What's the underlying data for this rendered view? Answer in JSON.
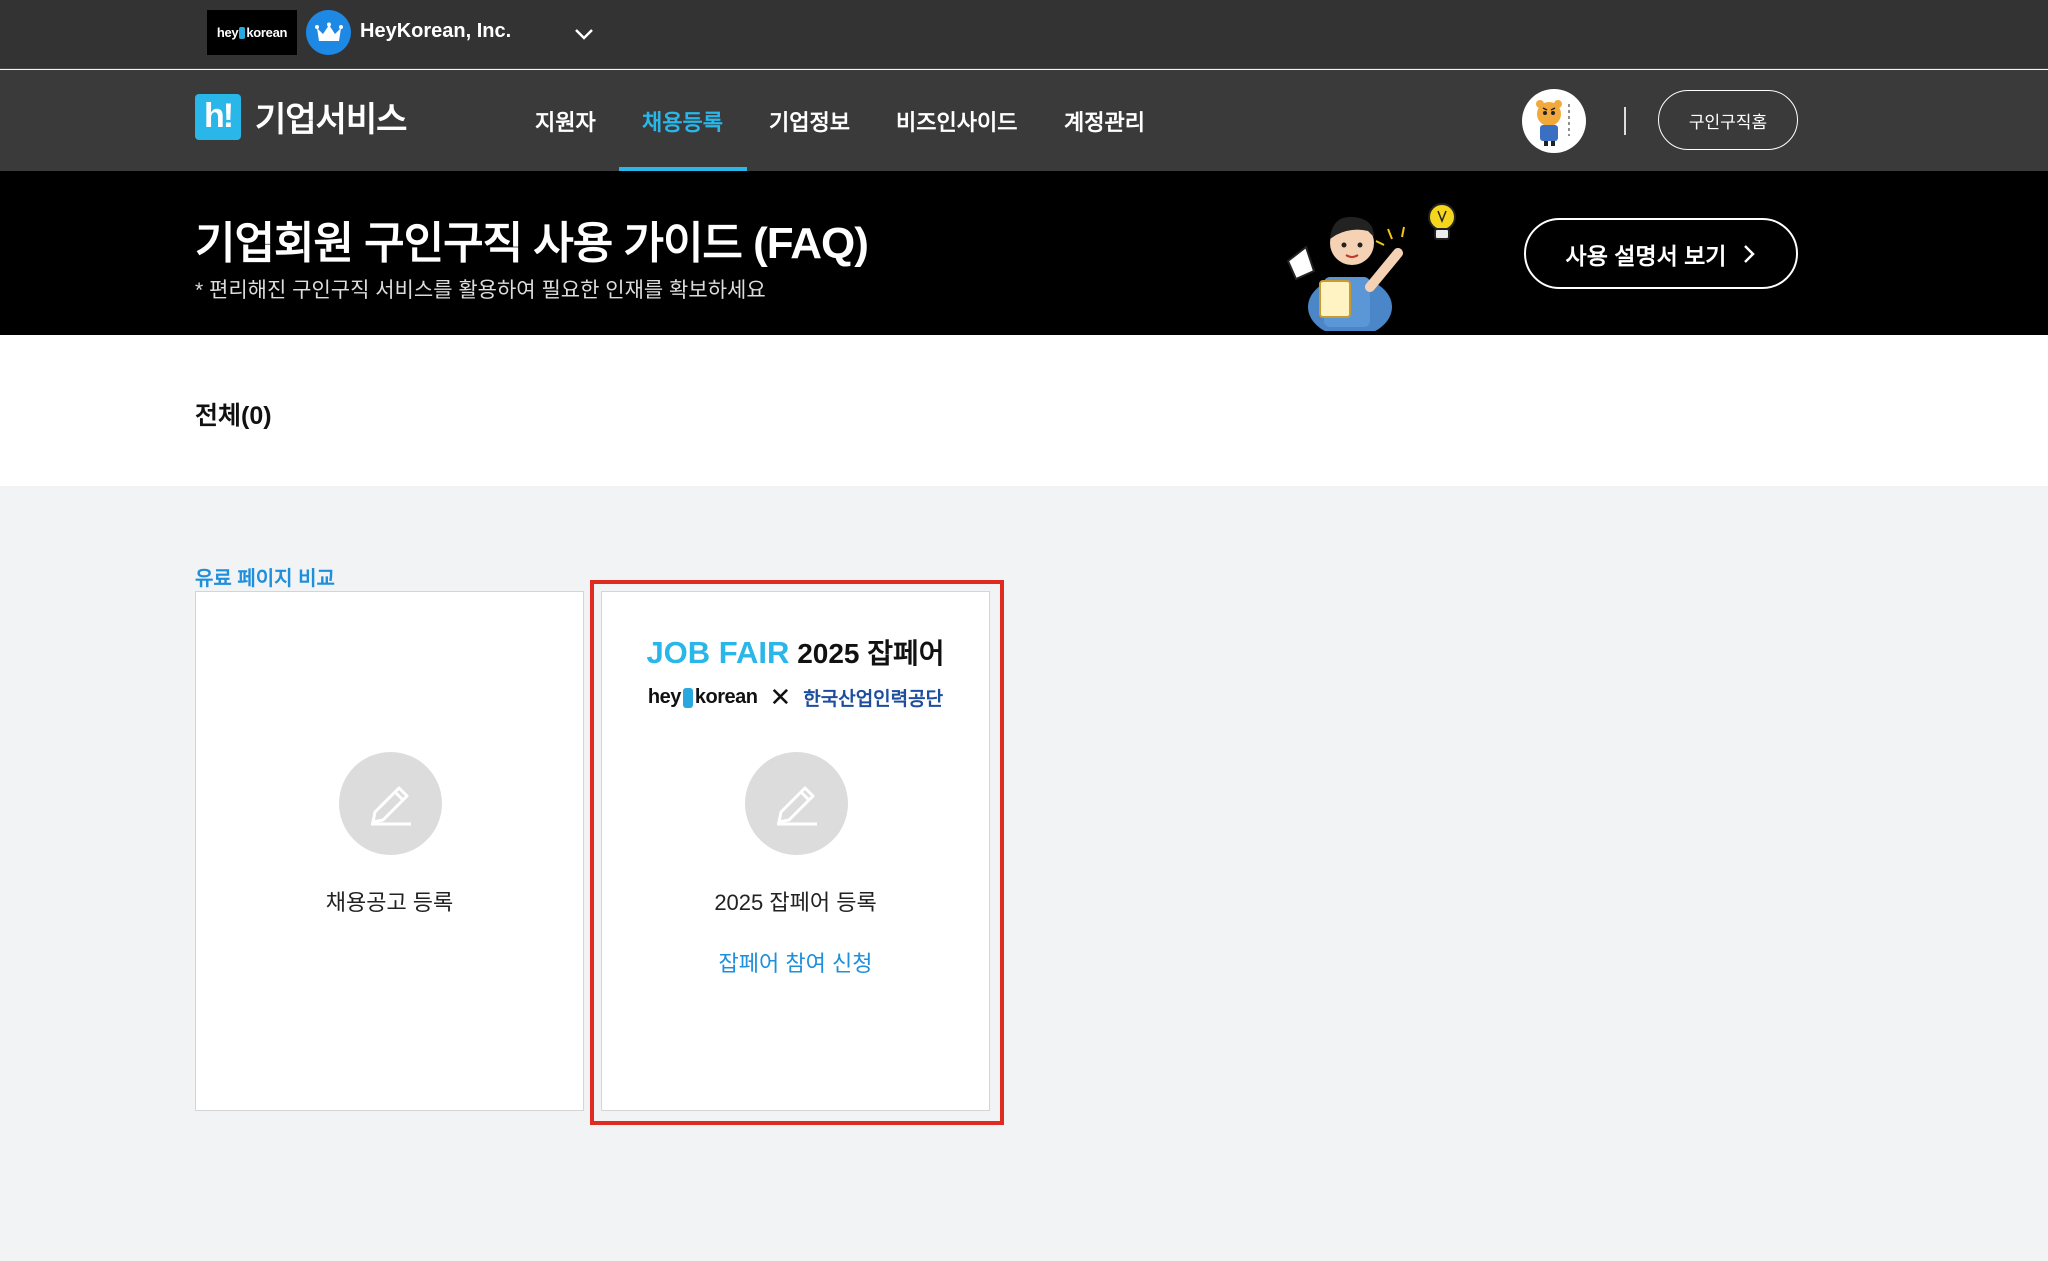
{
  "topbar": {
    "logo_text_left": "hey",
    "logo_text_right": "korean",
    "company_name": "HeyKorean, Inc."
  },
  "nav": {
    "brand_mark": "h!",
    "brand_name": "기업서비스",
    "items": [
      {
        "label": "지원자"
      },
      {
        "label": "채용등록",
        "active": true
      },
      {
        "label": "기업정보"
      },
      {
        "label": "비즈인사이드"
      },
      {
        "label": "계정관리"
      }
    ],
    "home_button": "구인구직홈"
  },
  "banner": {
    "title": "기업회원 구인구직 사용 가이드 (FAQ)",
    "subtitle": "* 편리해진 구인구직 서비스를 활용하여 필요한 인재를 확보하세요",
    "manual_button": "사용 설명서 보기"
  },
  "filter": {
    "all_label": "전체(0)"
  },
  "cards_section": {
    "compare_link": "유료 페이지 비교",
    "card1": {
      "label": "채용공고 등록"
    },
    "card2": {
      "title_blue": "JOB FAIR",
      "title_rest": "2025 잡페어",
      "partner_left_a": "hey",
      "partner_left_b": "korean",
      "partner_x": "✕",
      "partner_right": "한국산업인력공단",
      "label": "2025 잡페어 등록",
      "link": "잡페어 참여 신청"
    }
  },
  "colors": {
    "accent": "#29b6e8",
    "link": "#1e8fdb",
    "highlight": "#e02b20"
  }
}
